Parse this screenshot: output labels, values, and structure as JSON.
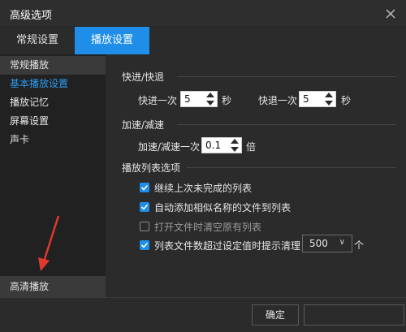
{
  "window": {
    "title": "高级选项"
  },
  "tabs": [
    {
      "label": "常规设置",
      "active": false
    },
    {
      "label": "播放设置",
      "active": true
    }
  ],
  "sidebar": {
    "items": [
      {
        "label": "常规播放",
        "state": "hover"
      },
      {
        "label": "基本播放设置",
        "state": "active"
      },
      {
        "label": "播放记忆",
        "state": "normal"
      },
      {
        "label": "屏幕设置",
        "state": "normal"
      },
      {
        "label": "声卡",
        "state": "normal"
      }
    ],
    "bottom_item": {
      "label": "高清播放"
    }
  },
  "seek": {
    "section_title": "快进/快退",
    "forward_label": "快进一次",
    "forward_value": "5",
    "forward_unit": "秒",
    "backward_label": "快退一次",
    "backward_value": "5",
    "backward_unit": "秒"
  },
  "speed": {
    "section_title": "加速/减速",
    "label": "加速/减速一次",
    "value": "0.1",
    "unit": "倍"
  },
  "playlist": {
    "section_title": "播放列表选项",
    "options": [
      {
        "label": "继续上次未完成的列表",
        "checked": true,
        "enabled": true
      },
      {
        "label": "自动添加相似名称的文件到列表",
        "checked": true,
        "enabled": true
      },
      {
        "label": "打开文件时清空原有列表",
        "checked": false,
        "enabled": false
      },
      {
        "label": "列表文件数超过设定值时提示清理",
        "checked": true,
        "enabled": true
      }
    ],
    "limit_value": "500",
    "limit_unit": "个"
  },
  "footer": {
    "ok_label": "确定",
    "cancel_label": ""
  },
  "colors": {
    "accent": "#1e8ee8",
    "active_text": "#2b9cf2",
    "annotation_arrow": "#e03a2f"
  }
}
